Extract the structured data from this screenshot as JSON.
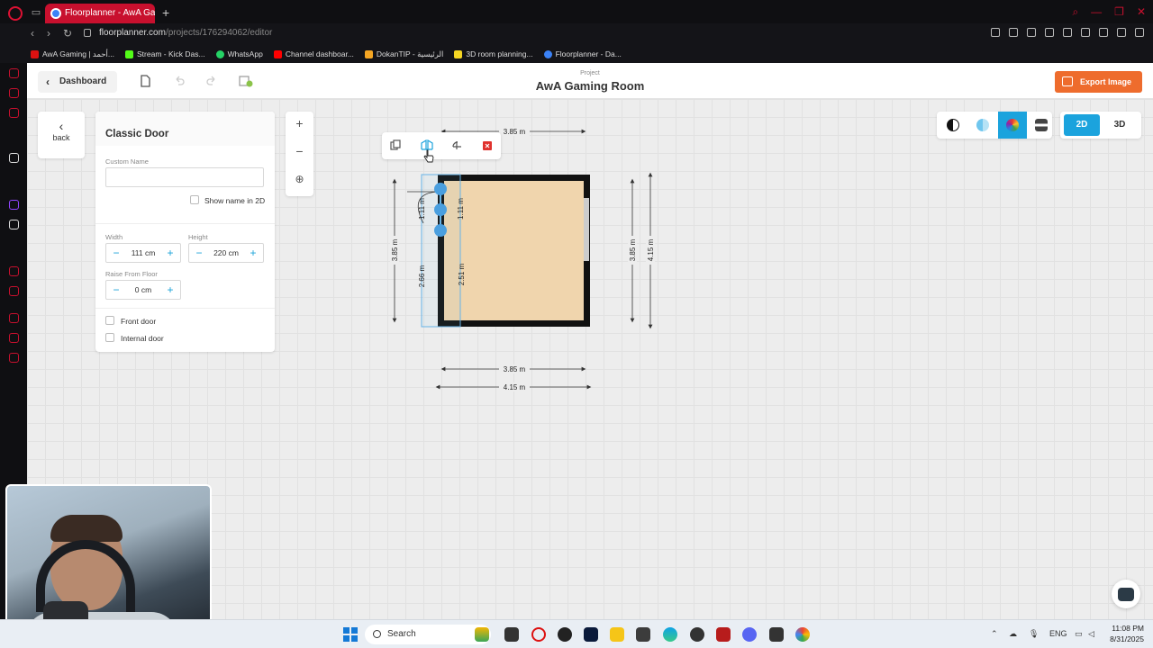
{
  "browser": {
    "tab_title": "Floorplanner - AwA Gamin",
    "url_host": "floorplanner.com",
    "url_path": "/projects/176294062/editor",
    "bookmarks": [
      {
        "label": "AwA Gaming | أحمد...",
        "color": "#d11"
      },
      {
        "label": "Stream - Kick Das...",
        "color": "#53fc18"
      },
      {
        "label": "WhatsApp",
        "color": "#25d366"
      },
      {
        "label": "Channel dashboar...",
        "color": "#f00"
      },
      {
        "label": "DokanTIP - الرئيسية",
        "color": "#f5a623"
      },
      {
        "label": "3D room planning...",
        "color": "#f5d623"
      },
      {
        "label": "Floorplanner - Da...",
        "color": "#3b82f6"
      }
    ]
  },
  "header": {
    "dashboard_label": "Dashboard",
    "project_label": "Project",
    "project_title": "AwA Gaming Room",
    "export_label": "Export Image"
  },
  "back": {
    "label": "back"
  },
  "panel": {
    "title": "Classic Door",
    "custom_name_label": "Custom Name",
    "custom_name_value": "",
    "show_name_label": "Show name in 2D",
    "width_label": "Width",
    "width_value": "111 cm",
    "height_label": "Height",
    "height_value": "220 cm",
    "raise_label": "Raise From Floor",
    "raise_value": "0 cm",
    "front_door_label": "Front door",
    "internal_door_label": "Internal door"
  },
  "view": {
    "mode_2d": "2D",
    "mode_3d": "3D",
    "active_mode": "2D",
    "accent": "#1ba3dd"
  },
  "plan": {
    "dim_top": "3.85 m",
    "dim_bottom_inner": "3.85 m",
    "dim_bottom_outer": "4.15 m",
    "dim_left": "3.85 m",
    "dim_right_inner": "3.85 m",
    "dim_right_outer": "4.15 m",
    "door_dim_left": "1.11 m",
    "door_dim_right": "1.11 m",
    "wall_dim_left": "2.66 m",
    "wall_dim_right": "2.51 m",
    "floor_color": "#f0d5ad"
  },
  "taskbar": {
    "search_label": "Search",
    "lang": "ENG",
    "time": "11:08 PM",
    "date": "8/31/2025"
  }
}
